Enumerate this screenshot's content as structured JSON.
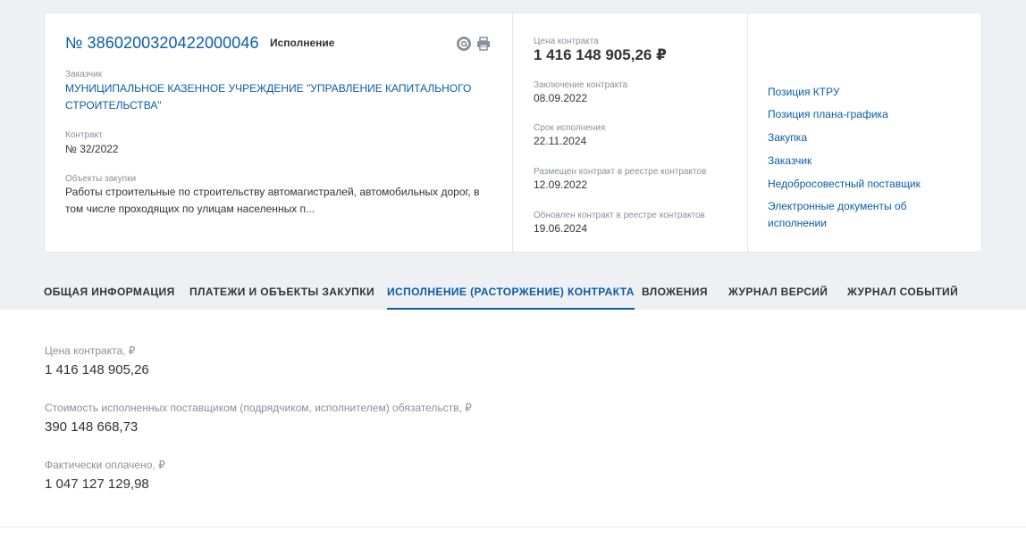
{
  "contract": {
    "reg_number": "№ 3860200320422000046",
    "status": "Исполнение",
    "customer_label": "Заказчик",
    "customer_name": "МУНИЦИПАЛЬНОЕ КАЗЕННОЕ УЧРЕЖДЕНИЕ \"УПРАВЛЕНИЕ КАПИТАЛЬНОГО СТРОИТЕЛЬСТВА\"",
    "contract_label": "Контракт",
    "contract_number": "№ 32/2022",
    "objects_label": "Объекты закупки",
    "objects_text": "Работы строительные по строительству автомагистралей, автомобильных дорог, в том числе проходящих по улицам населенных п..."
  },
  "icons": {
    "email": "email-icon",
    "print": "print-icon"
  },
  "details": {
    "price_label": "Цена контракта",
    "price_value": "1 416 148 905,26 ₽",
    "conclusion_label": "Заключение контракта",
    "conclusion_date": "08.09.2022",
    "term_label": "Срок исполнения",
    "term_date": "22.11.2024",
    "placed_label": "Размещен контракт в реестре контрактов",
    "placed_date": "12.09.2022",
    "updated_label": "Обновлен контракт в реестре контрактов",
    "updated_date": "19.06.2024"
  },
  "side_links": [
    "Позиция КТРУ",
    "Позиция плана-графика",
    "Закупка",
    "Заказчик",
    "Недобросовестный поставщик",
    "Электронные документы об исполнении"
  ],
  "tabs": [
    "ОБЩАЯ ИНФОРМАЦИЯ",
    "ПЛАТЕЖИ И ОБЪЕКТЫ ЗАКУПКИ",
    "ИСПОЛНЕНИЕ (РАСТОРЖЕНИЕ) КОНТРАКТА",
    "ВЛОЖЕНИЯ",
    "ЖУРНАЛ ВЕРСИЙ",
    "ЖУРНАЛ СОБЫТИЙ"
  ],
  "active_tab": "ИСПОЛНЕНИЕ (РАСТОРЖЕНИЕ) КОНТРАКТА",
  "execution": {
    "price_label": "Цена контракта, ₽",
    "price_value": "1 416 148 905,26",
    "fulfilled_label": "Стоимость исполненных поставщиком (подрядчиком, исполнителем) обязательств, ₽",
    "fulfilled_value": "390 148 668,73",
    "paid_label": "Фактически оплачено, ₽",
    "paid_value": "1 047 127 129,98"
  },
  "colors": {
    "accent": "#0a5ca8",
    "text": "#333333",
    "muted": "#8a8f98",
    "header_bg": "#eef0f4"
  }
}
